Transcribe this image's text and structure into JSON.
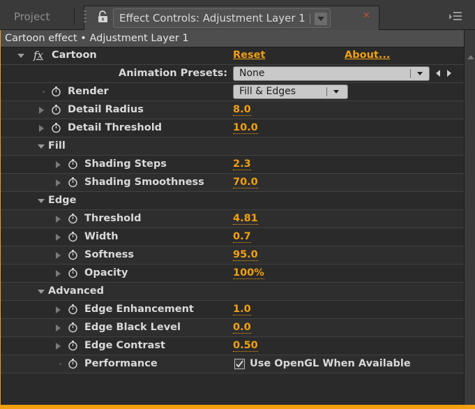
{
  "tabs": {
    "project": "Project",
    "active_title": "Effect Controls: Adjustment Layer 1"
  },
  "breadcrumb": "Cartoon effect • Adjustment Layer 1",
  "effect": {
    "fx_glyph": "fx",
    "name": "Cartoon",
    "reset": "Reset",
    "about": "About..."
  },
  "presets": {
    "label": "Animation Presets:",
    "value": "None"
  },
  "params": {
    "render": {
      "label": "Render",
      "value": "Fill & Edges"
    },
    "detail_radius": {
      "label": "Detail Radius",
      "value": "8.0"
    },
    "detail_threshold": {
      "label": "Detail Threshold",
      "value": "10.0"
    },
    "fill": "Fill",
    "shading_steps": {
      "label": "Shading Steps",
      "value": "2.3"
    },
    "shading_smoothness": {
      "label": "Shading Smoothness",
      "value": "70.0"
    },
    "edge": "Edge",
    "threshold": {
      "label": "Threshold",
      "value": "4.81"
    },
    "width": {
      "label": "Width",
      "value": "0.7"
    },
    "softness": {
      "label": "Softness",
      "value": "95.0"
    },
    "opacity": {
      "label": "Opacity",
      "value": "100%"
    },
    "advanced": "Advanced",
    "edge_enhancement": {
      "label": "Edge Enhancement",
      "value": "1.0"
    },
    "edge_black_level": {
      "label": "Edge Black Level",
      "value": "0.0"
    },
    "edge_contrast": {
      "label": "Edge Contrast",
      "value": "0.50"
    },
    "performance": {
      "label": "Performance",
      "checkbox_label": "Use OpenGL When Available",
      "checked": true
    }
  },
  "colors": {
    "accent": "#f2a010",
    "panel_bg": "#2a2a2a",
    "tab_bg": "#3a3a3a"
  },
  "icons": [
    "lock-icon",
    "close-icon",
    "panel-menu-icon",
    "stopwatch-icon",
    "disclosure-triangle-icon",
    "checkbox-icon"
  ]
}
